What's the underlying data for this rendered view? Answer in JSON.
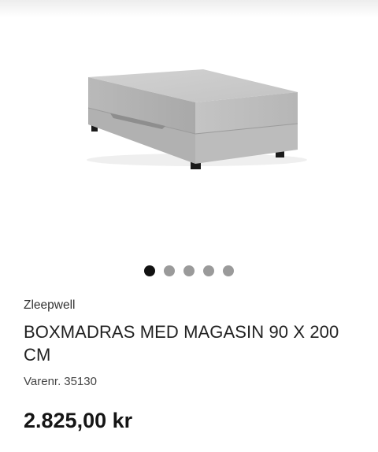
{
  "product": {
    "image_alt": "boxmadras-grey-icon",
    "brand": "Zleepwell",
    "title": "BOXMADRAS MED MAGASIN 90 X 200 CM",
    "sku_label": "Varenr.",
    "sku_value": "35130",
    "price": "2.825,00 kr"
  },
  "carousel": {
    "total_slides": 5,
    "active_index": 0
  },
  "colors": {
    "fabric": "#b9b9b9",
    "dot_active": "#111111",
    "dot_inactive": "#9a9a9a"
  }
}
